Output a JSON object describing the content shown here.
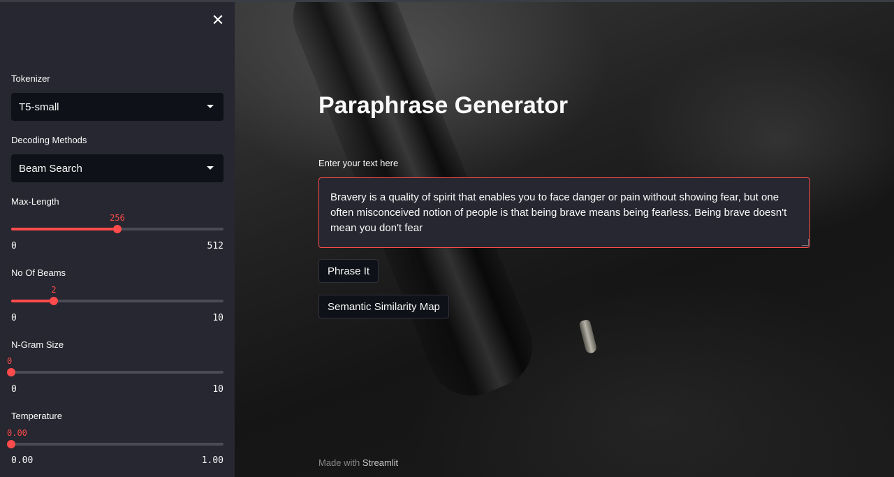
{
  "sidebar": {
    "close_icon": "close-icon",
    "tokenizer": {
      "label": "Tokenizer",
      "value": "T5-small"
    },
    "decoding": {
      "label": "Decoding Methods",
      "value": "Beam Search"
    },
    "max_length": {
      "label": "Max-Length",
      "value": "256",
      "min": "0",
      "max": "512",
      "fraction": 0.5
    },
    "num_beams": {
      "label": "No Of Beams",
      "value": "2",
      "min": "0",
      "max": "10",
      "fraction": 0.2
    },
    "ngram_size": {
      "label": "N-Gram Size",
      "value": "0",
      "min": "0",
      "max": "10",
      "fraction": 0.0
    },
    "temperature": {
      "label": "Temperature",
      "value": "0.00",
      "min": "0.00",
      "max": "1.00",
      "fraction": 0.0
    }
  },
  "main": {
    "title": "Paraphrase Generator",
    "input_label": "Enter your text here",
    "input_value": "Bravery is a quality of spirit that enables you to face danger or pain without showing fear, but one often misconceived notion of people is that being brave means being fearless. Being brave doesn't mean you don't fear",
    "phrase_button": "Phrase It",
    "similarity_button": "Semantic Similarity Map",
    "footer_prefix": "Made with",
    "footer_brand": "Streamlit"
  },
  "colors": {
    "accent": "#ff4b4b",
    "sidebar_bg": "#262730",
    "input_bg": "#0e1117"
  }
}
